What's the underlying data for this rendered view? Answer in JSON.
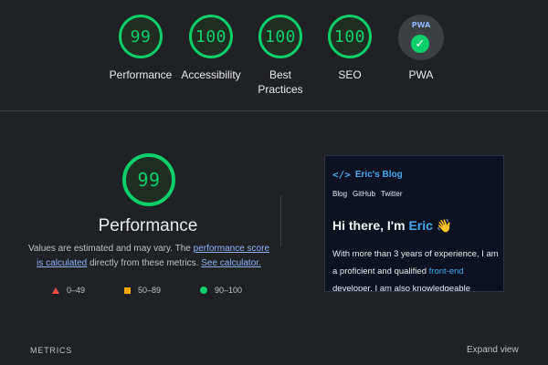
{
  "summary": {
    "categories": [
      {
        "score": "99",
        "label": "Performance"
      },
      {
        "score": "100",
        "label": "Accessibility"
      },
      {
        "score": "100",
        "label": "Best Practices"
      },
      {
        "score": "100",
        "label": "SEO"
      }
    ],
    "pwa": {
      "badge_text": "PWA",
      "label": "PWA",
      "check_glyph": "✓"
    }
  },
  "performance": {
    "score": "99",
    "title": "Performance",
    "desc_part1": "Values are estimated and may vary. The ",
    "desc_link1": "performance score is calculated",
    "desc_part2": " directly from these metrics. ",
    "desc_link2": "See calculator."
  },
  "legend": [
    {
      "range": "0–49",
      "icon": "triangle-icon",
      "color": "#ff4e42"
    },
    {
      "range": "50–89",
      "icon": "square-icon",
      "color": "#ffa400"
    },
    {
      "range": "90–100",
      "icon": "circle-icon",
      "color": "#0cce6b"
    }
  ],
  "screenshot": {
    "code_icon": "</>",
    "blog_name": "Eric's Blog",
    "nav": [
      "Blog",
      "GitHub",
      "Twitter"
    ],
    "hero_prefix": "Hi there, I'm ",
    "hero_name": "Eric",
    "hero_wave": "👋",
    "intro_1": "With more than 3 years of experience, I am a proficient and qualified ",
    "intro_accent": "front-end",
    "intro_2": " developer. I am also knowledgeable"
  },
  "metrics": {
    "label": "METRICS",
    "expand_label": "Expand view"
  },
  "colors": {
    "pass": "#0cce6b",
    "average": "#ffa400",
    "fail": "#ff4e42",
    "link": "#8ab4f8",
    "blog_accent": "#46a6e8"
  }
}
